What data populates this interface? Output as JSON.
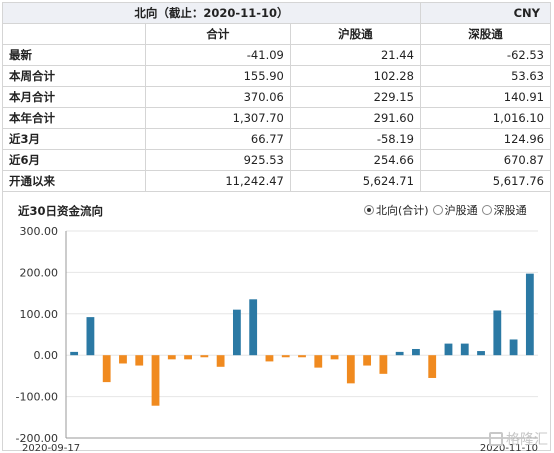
{
  "header": {
    "title": "北向（截止：2020-11-10）",
    "currency": "CNY"
  },
  "columns": [
    "合计",
    "沪股通",
    "深股通"
  ],
  "rows": [
    {
      "label": "最新",
      "values": [
        "-41.09",
        "21.44",
        "-62.53"
      ]
    },
    {
      "label": "本周合计",
      "values": [
        "155.90",
        "102.28",
        "53.63"
      ]
    },
    {
      "label": "本月合计",
      "values": [
        "370.06",
        "229.15",
        "140.91"
      ]
    },
    {
      "label": "本年合计",
      "values": [
        "1,307.70",
        "291.60",
        "1,016.10"
      ]
    },
    {
      "label": "近3月",
      "values": [
        "66.77",
        "-58.19",
        "124.96"
      ]
    },
    {
      "label": "近6月",
      "values": [
        "925.53",
        "254.66",
        "670.87"
      ]
    },
    {
      "label": "开通以来",
      "values": [
        "11,242.47",
        "5,624.71",
        "5,617.76"
      ]
    }
  ],
  "chart_title": "近30日资金流向",
  "legend_options": [
    {
      "label": "北向(合计)",
      "selected": true
    },
    {
      "label": "沪股通",
      "selected": false
    },
    {
      "label": "深股通",
      "selected": false
    }
  ],
  "watermark": "格隆汇",
  "chart_data": {
    "type": "bar",
    "ylim": [
      -200,
      300
    ],
    "yticks": [
      "300.00",
      "200.00",
      "100.00",
      "0.00",
      "-100.00",
      "-200.00"
    ],
    "ytick_values": [
      300,
      200,
      100,
      0,
      -100,
      -200
    ],
    "x_start_label": "2020-09-17",
    "x_end_label": "2020-11-10",
    "colors": {
      "positive": "#2b79a4",
      "negative": "#f08a1f"
    },
    "values": [
      8,
      92,
      -65,
      -20,
      -25,
      -122,
      -10,
      -10,
      -5,
      -28,
      110,
      135,
      -15,
      -5,
      -5,
      -30,
      -10,
      -68,
      -25,
      -45,
      8,
      15,
      -55,
      28,
      28,
      10,
      108,
      38,
      197
    ]
  }
}
